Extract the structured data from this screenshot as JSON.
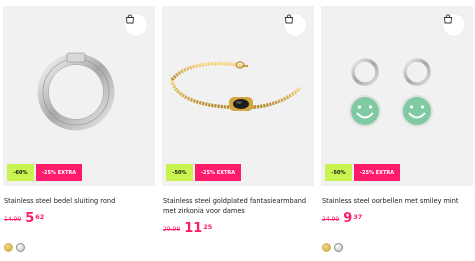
{
  "products": [
    {
      "title": "Stainless steel bedel sluiting rond",
      "old_price": "14.99",
      "price_main": "5",
      "price_cents": "62",
      "badge_green": "-60%",
      "badge_pink": "-25% EXTRA",
      "swatches": [
        "gold",
        "silver"
      ],
      "cart_icon": "shopping-bag-icon"
    },
    {
      "title": "Stainless steel goldplated fantasiearmband met zirkonia voor dames",
      "old_price": "29.99",
      "price_main": "11",
      "price_cents": "25",
      "badge_green": "-50%",
      "badge_pink": "-25% EXTRA",
      "swatches": [],
      "cart_icon": "shopping-bag-icon"
    },
    {
      "title": "Stainless steel oorbellen met smiley mint",
      "old_price": "24.99",
      "price_main": "9",
      "price_cents": "37",
      "badge_green": "-50%",
      "badge_pink": "-25% EXTRA",
      "swatches": [
        "gold",
        "silver"
      ],
      "cart_icon": "shopping-bag-icon"
    }
  ],
  "colors": {
    "accent_pink": "#ff1b6b",
    "badge_green": "#c9f34e",
    "image_bg": "#f1f1f1",
    "smiley_mint": "#7fc9a3"
  }
}
